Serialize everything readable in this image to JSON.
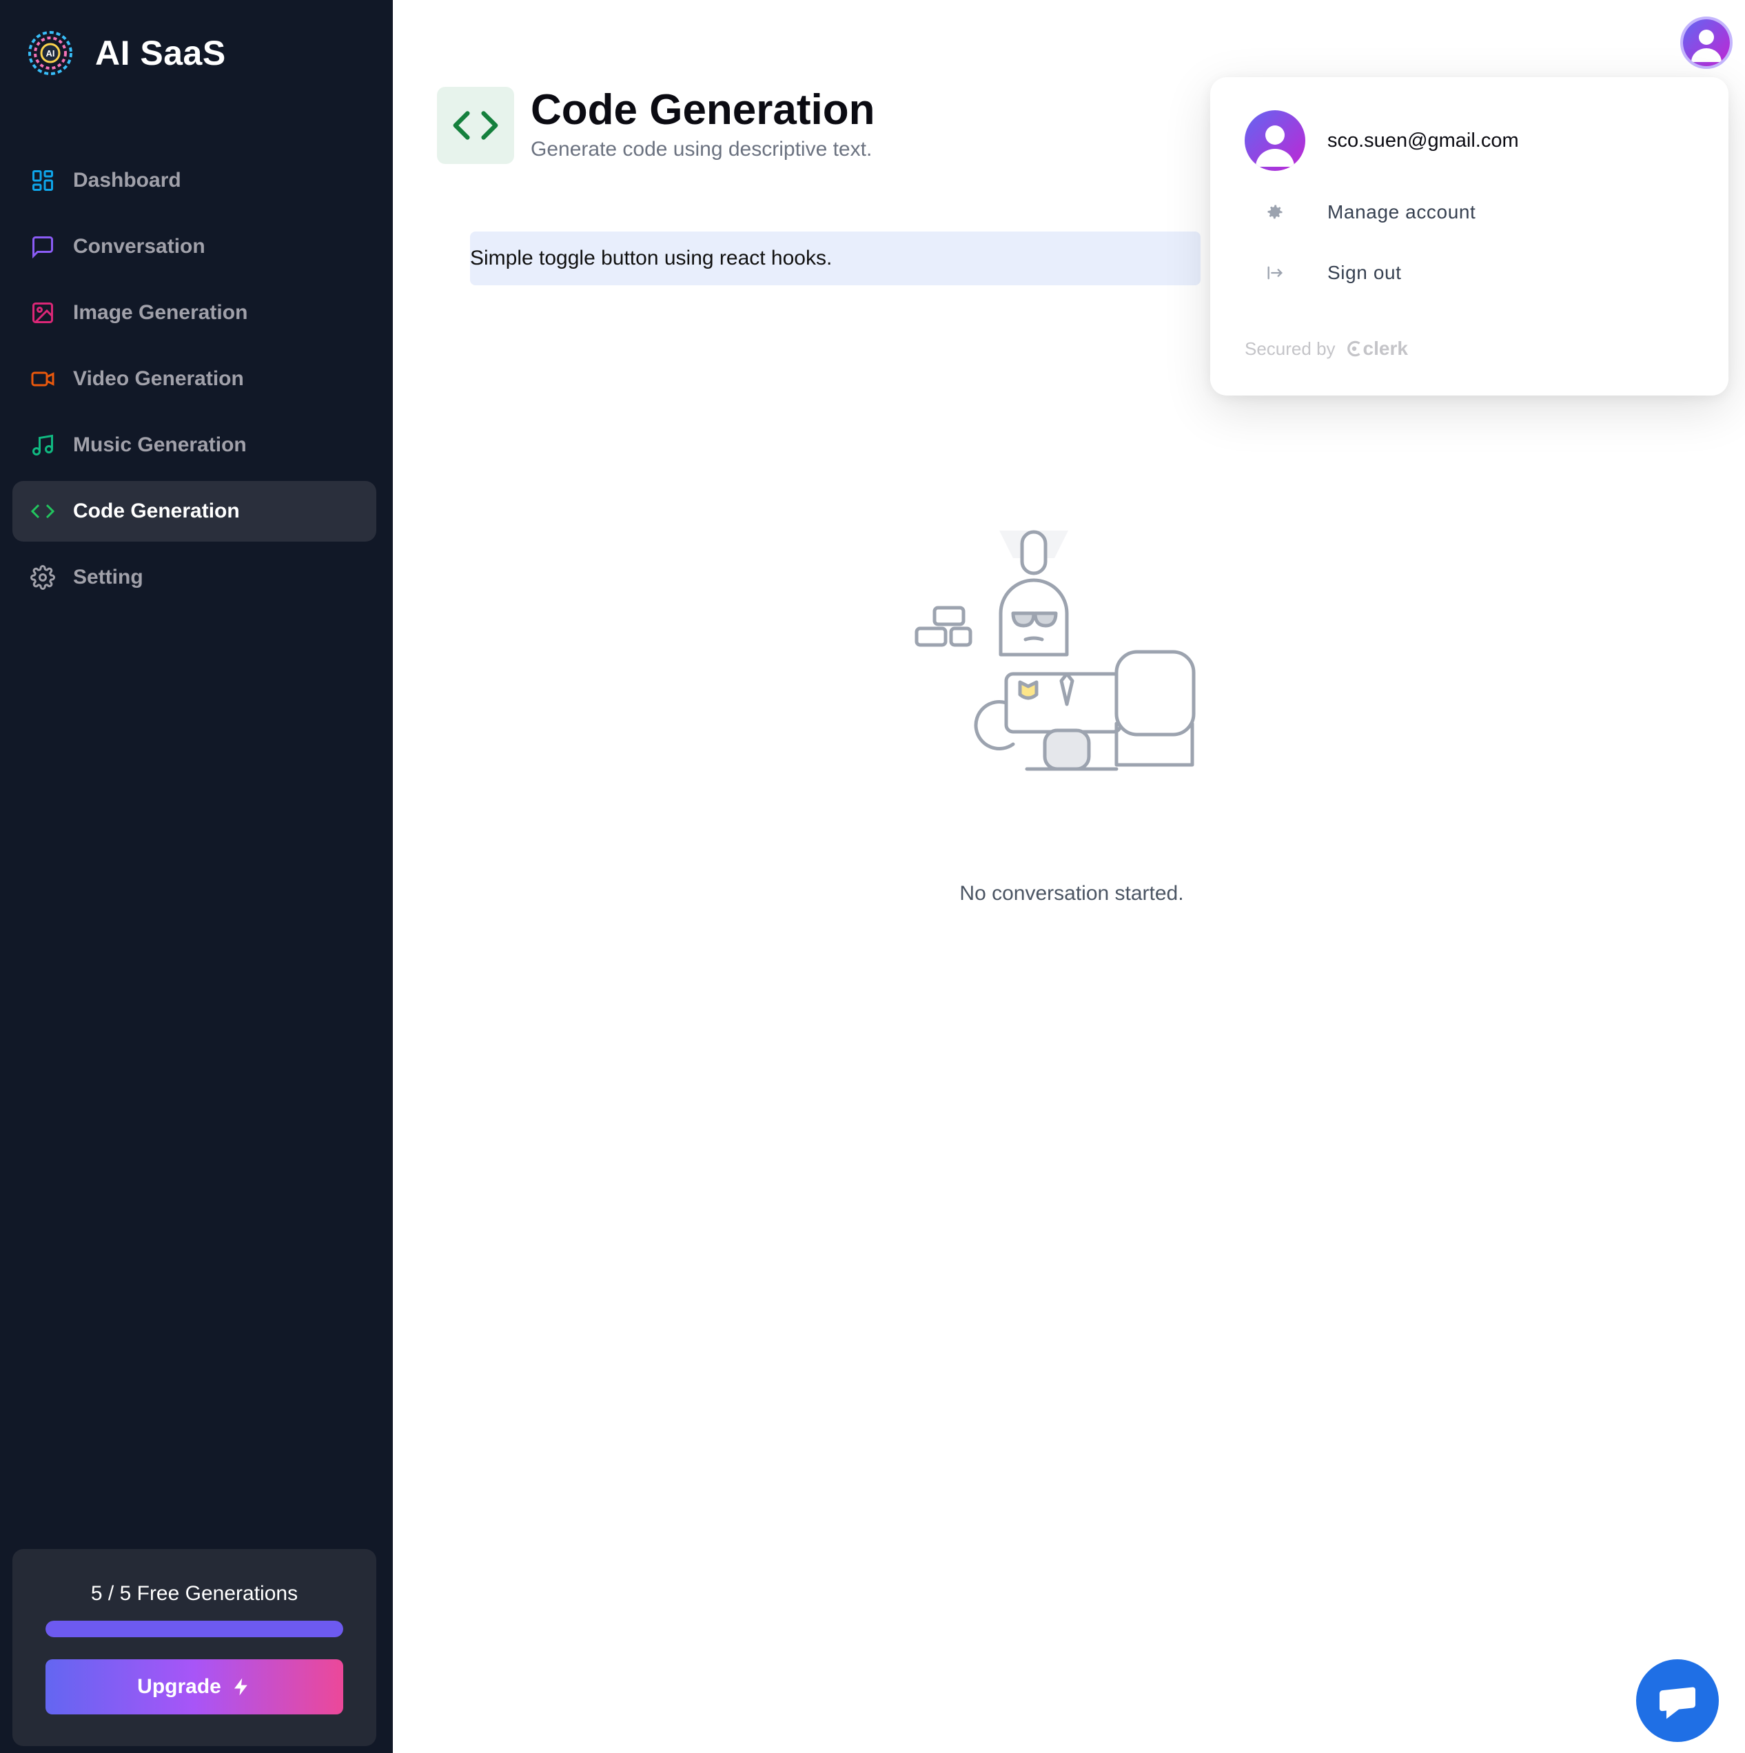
{
  "app": {
    "name": "AI SaaS"
  },
  "sidebar": {
    "items": [
      {
        "label": "Dashboard",
        "icon": "dashboard-icon",
        "color": "#0ea5e9"
      },
      {
        "label": "Conversation",
        "icon": "message-square-icon",
        "color": "#8b5cf6"
      },
      {
        "label": "Image Generation",
        "icon": "image-icon",
        "color": "#db2777"
      },
      {
        "label": "Video Generation",
        "icon": "video-icon",
        "color": "#ea580c"
      },
      {
        "label": "Music Generation",
        "icon": "music-icon",
        "color": "#10b981"
      },
      {
        "label": "Code Generation",
        "icon": "code-icon",
        "color": "#22c55e",
        "active": true
      },
      {
        "label": "Setting",
        "icon": "settings-icon",
        "color": "#a1a1aa"
      }
    ],
    "free_generations": {
      "text": "5 / 5 Free Generations",
      "used": 5,
      "total": 5
    },
    "upgrade_label": "Upgrade"
  },
  "page": {
    "title": "Code Generation",
    "subtitle": "Generate code using descriptive text.",
    "icon": "code-icon",
    "accent": "#15803d"
  },
  "prompt": {
    "value": "Simple toggle button using react hooks."
  },
  "empty_state": {
    "text": "No conversation started."
  },
  "user_menu": {
    "email": "sco.suen@gmail.com",
    "manage_label": "Manage account",
    "signout_label": "Sign out",
    "secured_by": "Secured by",
    "provider": "clerk"
  },
  "colors": {
    "sidebar_bg": "#111827",
    "avatar_gradient": [
      "#6366f1",
      "#a855f7"
    ],
    "chat_button": "#1f6fe5"
  }
}
